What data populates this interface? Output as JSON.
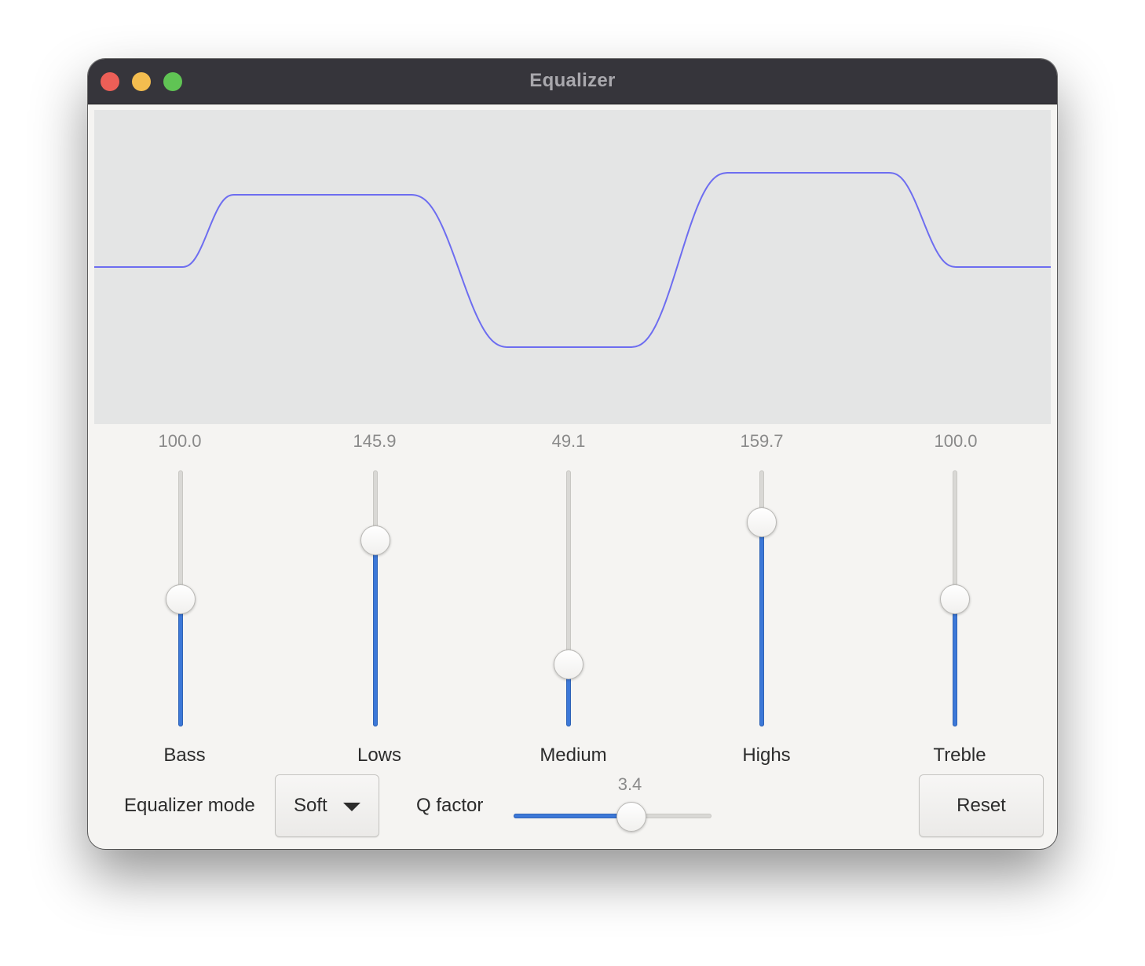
{
  "window": {
    "title": "Equalizer"
  },
  "curve": {
    "color": "#6d6df0",
    "background": "#e4e5e5"
  },
  "bands": [
    {
      "label": "Bass",
      "value": "100.0",
      "level": 0.5
    },
    {
      "label": "Lows",
      "value": "145.9",
      "level": 0.73
    },
    {
      "label": "Medium",
      "value": "49.1",
      "level": 0.245
    },
    {
      "label": "Highs",
      "value": "159.7",
      "level": 0.8
    },
    {
      "label": "Treble",
      "value": "100.0",
      "level": 0.5
    }
  ],
  "controls": {
    "mode_label": "Equalizer mode",
    "mode_value": "Soft",
    "q_label": "Q factor",
    "q_value": "3.4",
    "q_level": 0.59,
    "reset_label": "Reset"
  },
  "colors": {
    "accent": "#3c78d8",
    "titlebar": "#36353b",
    "close": "#ec5f57",
    "minimize": "#f4bd4f",
    "maximize": "#60c454"
  }
}
